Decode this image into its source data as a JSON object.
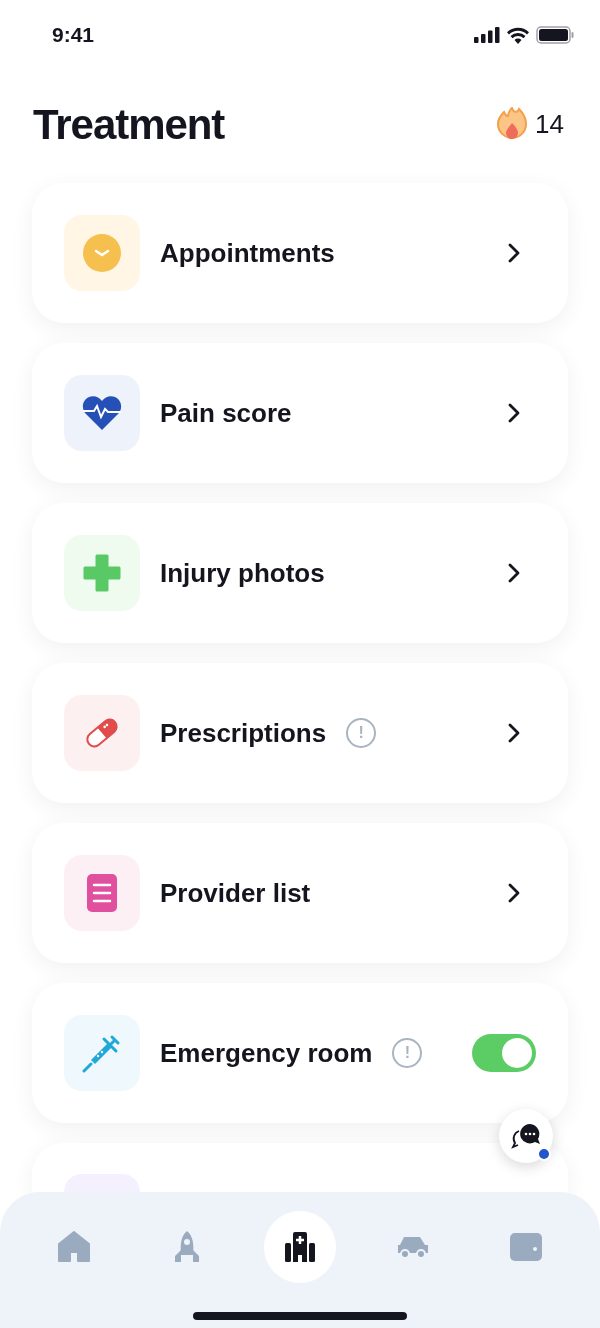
{
  "status_bar": {
    "time": "9:41"
  },
  "header": {
    "title": "Treatment",
    "streak": "14"
  },
  "items": [
    {
      "kind": "link",
      "label": "Appointments"
    },
    {
      "kind": "link",
      "label": "Pain score"
    },
    {
      "kind": "link",
      "label": "Injury photos"
    },
    {
      "kind": "link",
      "label": "Prescriptions",
      "info_mark": "!"
    },
    {
      "kind": "link",
      "label": "Provider list"
    },
    {
      "kind": "toggle",
      "label": "Emergency room",
      "info_mark": "!",
      "on": true
    },
    {
      "kind": "partial"
    }
  ],
  "chat": {
    "unread": true
  },
  "nav": [
    {
      "selected": false
    },
    {
      "selected": false
    },
    {
      "selected": true
    },
    {
      "selected": false
    },
    {
      "selected": false
    }
  ]
}
